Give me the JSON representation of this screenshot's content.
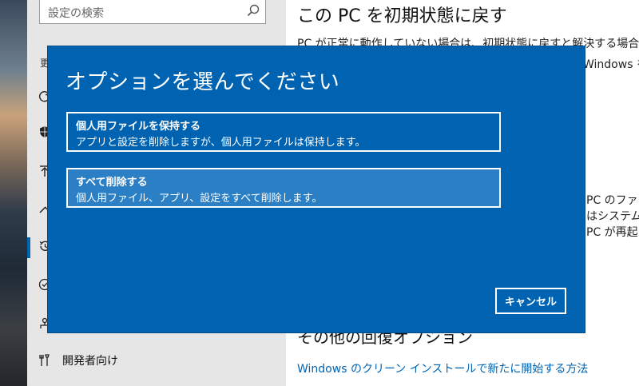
{
  "settings": {
    "search": {
      "placeholder": "設定の検索",
      "icon": "search-icon"
    },
    "nav": {
      "partial_label": "更",
      "items": [
        {
          "icon": "sync-icon"
        },
        {
          "icon": "shield-icon"
        },
        {
          "icon": "upload-icon"
        },
        {
          "icon": "wrench-icon"
        },
        {
          "icon": "history-icon",
          "active": true
        },
        {
          "icon": "check-circle-icon"
        },
        {
          "icon": "find-device-icon"
        }
      ],
      "developer": {
        "icon": "tools-icon",
        "label": "開発者向け"
      }
    },
    "content": {
      "heading": "この PC を初期状態に戻す",
      "description": "PC が正常に動作していない場合は、初期状態に戻すと解決する場合があ",
      "description_tail": "Windows を",
      "side_lines": [
        "PC のファー",
        "はシステム イ",
        "PC が再起"
      ],
      "other_heading": "その他の回復オプション",
      "link": "Windows のクリーン インストールで新たに開始する方法"
    }
  },
  "dialog": {
    "title": "オプションを選んでください",
    "options": [
      {
        "title": "個人用ファイルを保持する",
        "description": "アプリと設定を削除しますが、個人用ファイルは保持します。"
      },
      {
        "title": "すべて削除する",
        "description": "個人用ファイル、アプリ、設定をすべて削除します。"
      }
    ],
    "cancel_label": "キャンセル"
  },
  "colors": {
    "accent": "#0063b1",
    "selected_option": "#2b7fc4",
    "nav_bg": "#e6e6e6"
  }
}
